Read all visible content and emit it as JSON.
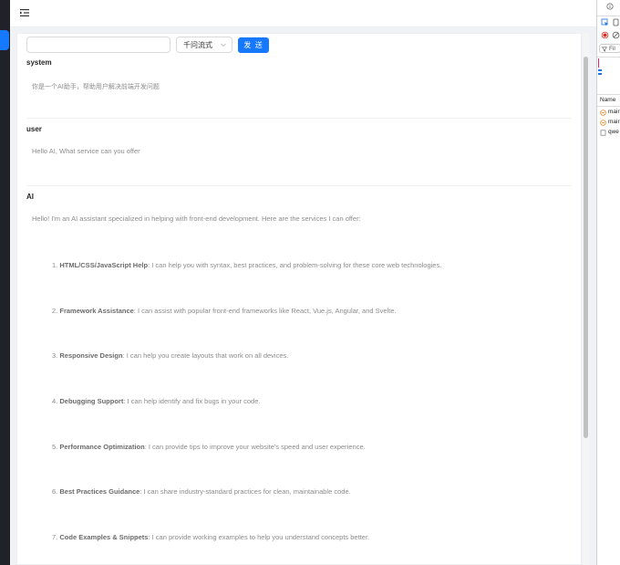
{
  "toolbar": {
    "input_value": "",
    "model_select": "千问流式",
    "send_label": "发 送"
  },
  "messages": [
    {
      "role": "system",
      "content": "你是一个AI助手，帮助用户解决前端开发问题"
    },
    {
      "role": "user",
      "content": "Hello AI, What service can you offer"
    },
    {
      "role": "AI",
      "content": "Hello! I'm an AI assistant specialized in helping with front-end development. Here are the services I can offer:"
    }
  ],
  "services": [
    {
      "num": "1.",
      "title": "HTML/CSS/JavaScript Help",
      "desc": ": I can help you with syntax, best practices, and problem-solving for these core web technologies."
    },
    {
      "num": "2.",
      "title": "Framework Assistance",
      "desc": ": I can assist with popular front-end frameworks like React, Vue.js, Angular, and Svelte."
    },
    {
      "num": "3.",
      "title": "Responsive Design",
      "desc": ": I can help you create layouts that work on all devices."
    },
    {
      "num": "4.",
      "title": "Debugging Support",
      "desc": ": I can help identify and fix bugs in your code."
    },
    {
      "num": "5.",
      "title": "Performance Optimization",
      "desc": ": I can provide tips to improve your website's speed and user experience."
    },
    {
      "num": "6.",
      "title": "Best Practices Guidance",
      "desc": ": I can share industry-standard practices for clean, maintainable code."
    },
    {
      "num": "7.",
      "title": "Code Examples & Snippets",
      "desc": ": I can provide working examples to help you understand concepts better."
    }
  ],
  "devtools": {
    "filter_label": "Fil",
    "name_header": "Name",
    "requests": [
      "mair",
      "mair",
      "qwe"
    ]
  },
  "colors": {
    "accent": "#1677ff",
    "sidebar": "#1f2329"
  }
}
